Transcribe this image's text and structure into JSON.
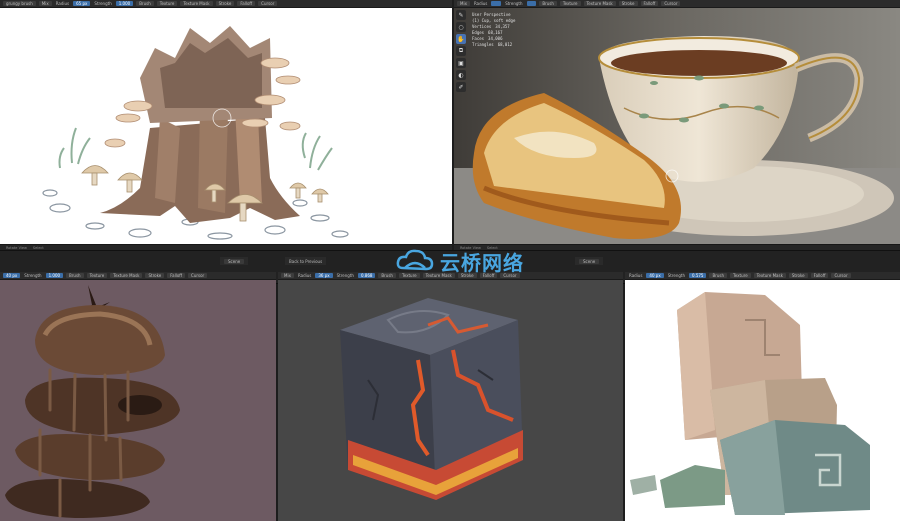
{
  "panels": {
    "top_left": {
      "toolbar": [
        "grungy brush",
        "Mix",
        "Radius",
        "65 px",
        "Strength",
        "1.000",
        "Brush",
        "Texture",
        "Texture Mask",
        "Stroke",
        "Falloff",
        "Cursor"
      ],
      "status": [
        "Rotate View",
        "Select"
      ]
    },
    "top_right": {
      "toolbar": [
        "Mix",
        "Radius",
        "Strength",
        "Brush",
        "Texture",
        "Texture Mask",
        "Stroke",
        "Falloff",
        "Cursor"
      ],
      "view_label": "User Perspective",
      "object_label": "(1) Cup, soft edge",
      "stats": [
        {
          "k": "Vertices",
          "v": "34,357"
        },
        {
          "k": "Edges",
          "v": "68,167"
        },
        {
          "k": "Faces",
          "v": "34,006"
        },
        {
          "k": "Triangles",
          "v": "68,012"
        }
      ],
      "status": [
        "Rotate View",
        "Select"
      ]
    },
    "bottom_left": {
      "toolbar": [
        "40 px",
        "Strength",
        "1.000",
        "Brush",
        "Texture",
        "Texture Mask",
        "Stroke",
        "Falloff",
        "Cursor"
      ]
    },
    "bottom_mid": {
      "toolbar": [
        "Mix",
        "Radius",
        "36 px",
        "Strength",
        "0.868",
        "Brush",
        "Texture",
        "Texture Mask",
        "Stroke",
        "Falloff",
        "Cursor"
      ]
    },
    "bottom_right": {
      "toolbar": [
        "Radius",
        "40 px",
        "Strength",
        "0.575",
        "Brush",
        "Texture",
        "Texture Mask",
        "Stroke",
        "Falloff",
        "Cursor"
      ]
    }
  },
  "midbar": {
    "scene_label": "Scene",
    "back_button": "Back to Previous"
  },
  "watermark": {
    "text": "云桥网络",
    "color": "#49a6e0"
  }
}
